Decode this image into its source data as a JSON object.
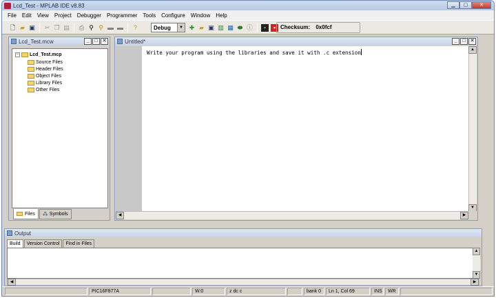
{
  "window": {
    "title": "Lcd_Test - MPLAB IDE v8.83"
  },
  "menu": [
    "File",
    "Edit",
    "View",
    "Project",
    "Debugger",
    "Programmer",
    "Tools",
    "Configure",
    "Window",
    "Help"
  ],
  "toolbar": {
    "build_config": "Debug",
    "checksum_label": "Checksum:",
    "checksum_value": "0x0fcf"
  },
  "project_window": {
    "title": "Lcd_Test.mcw",
    "root": "Lcd_Test.mcp",
    "folders": [
      "Source Files",
      "Header Files",
      "Object Files",
      "Library Files",
      "Other Files"
    ],
    "tabs": [
      "Files",
      "Symbols"
    ]
  },
  "editor_window": {
    "title": "Untitled*",
    "content": "Write your program using the libraries and save it with .c extension"
  },
  "output_window": {
    "title": "Output",
    "tabs": [
      "Build",
      "Version Control",
      "Find in Files"
    ]
  },
  "status_bar": {
    "device": "PIC16F877A",
    "w_reg": "W:0",
    "flags": "z dc c",
    "bank": "bank 0",
    "position": "Ln 1, Col 69",
    "ins": "INS",
    "wr": "WR"
  }
}
